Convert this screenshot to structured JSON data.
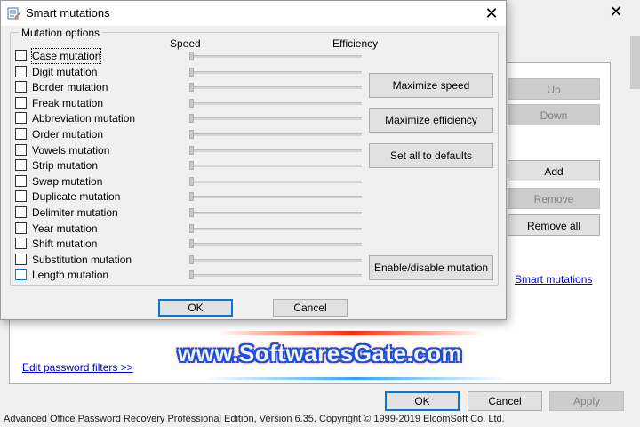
{
  "background": {
    "up_label": "Up",
    "down_label": "Down",
    "add_label": "Add",
    "remove_label": "Remove",
    "remove_all_label": "Remove all",
    "smart_mutations_link": "Smart mutations",
    "edit_filters_link": "Edit password filters >>",
    "ok_label": "OK",
    "cancel_label": "Cancel",
    "apply_label": "Apply",
    "status_text": "Advanced Office Password Recovery Professional Edition, Version 6.35. Copyright © 1999-2019 ElcomSoft Co. Ltd."
  },
  "dialog": {
    "title": "Smart mutations",
    "close_glyph": "✕",
    "group_label": "Mutation options",
    "speed_header": "Speed",
    "efficiency_header": "Efficiency",
    "mutations": [
      {
        "label": "Case mutation",
        "checked": false,
        "level": 0
      },
      {
        "label": "Digit mutation",
        "checked": false,
        "level": 0
      },
      {
        "label": "Border mutation",
        "checked": false,
        "level": 0
      },
      {
        "label": "Freak mutation",
        "checked": false,
        "level": 0
      },
      {
        "label": "Abbreviation mutation",
        "checked": false,
        "level": 0
      },
      {
        "label": "Order mutation",
        "checked": false,
        "level": 0
      },
      {
        "label": "Vowels mutation",
        "checked": false,
        "level": 0
      },
      {
        "label": "Strip mutation",
        "checked": false,
        "level": 0
      },
      {
        "label": "Swap mutation",
        "checked": false,
        "level": 0
      },
      {
        "label": "Duplicate mutation",
        "checked": false,
        "level": 0
      },
      {
        "label": "Delimiter mutation",
        "checked": false,
        "level": 0
      },
      {
        "label": "Year mutation",
        "checked": false,
        "level": 0
      },
      {
        "label": "Shift mutation",
        "checked": false,
        "level": 0
      },
      {
        "label": "Substitution mutation",
        "checked": false,
        "level": 0
      },
      {
        "label": "Length mutation",
        "checked": false,
        "level": 0
      }
    ],
    "maximize_speed_label": "Maximize speed",
    "maximize_efficiency_label": "Maximize efficiency",
    "set_defaults_label": "Set all to defaults",
    "enable_disable_label": "Enable/disable mutation",
    "ok_label": "OK",
    "cancel_label": "Cancel"
  },
  "watermark": {
    "text": "www.SoftwaresGate.com"
  }
}
